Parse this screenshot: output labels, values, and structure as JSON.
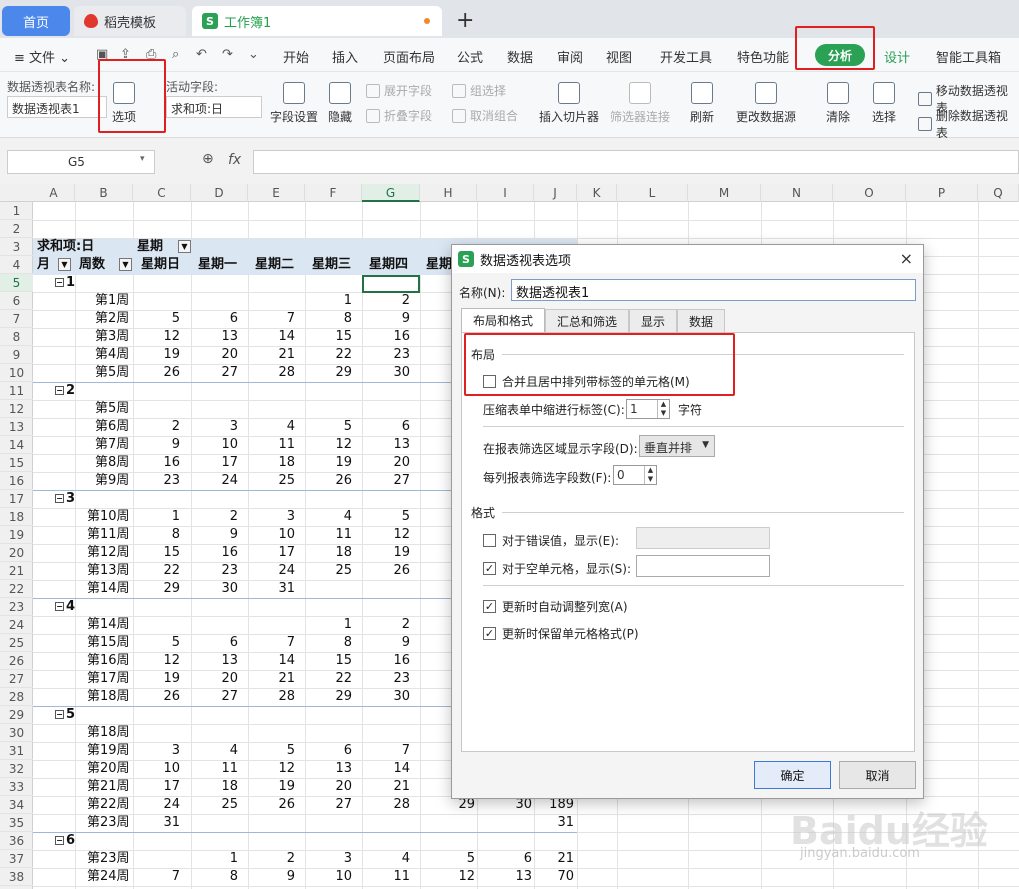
{
  "tabs": {
    "home": "首页",
    "templates": "稻壳模板",
    "workbook": "工作簿1",
    "new_tab": "+"
  },
  "menu": {
    "file": "文件",
    "items": [
      "开始",
      "插入",
      "页面布局",
      "公式",
      "数据",
      "审阅",
      "视图",
      "开发工具",
      "特色功能"
    ],
    "analyze": "分析",
    "design": "设计",
    "smart": "智能工具箱"
  },
  "ribbon": {
    "pivot_name_label": "数据透视表名称:",
    "pivot_name_value": "数据透视表1",
    "options": "选项",
    "active_field_label": "活动字段:",
    "active_field_value": "求和项:日",
    "field_settings": "字段设置",
    "hide": "隐藏",
    "expand_field": "展开字段",
    "collapse_field": "折叠字段",
    "group_selection": "组选择",
    "ungroup": "取消组合",
    "insert_slicer": "插入切片器",
    "filter_connections": "筛选器连接",
    "refresh": "刷新",
    "change_source": "更改数据源",
    "clear": "清除",
    "select": "选择",
    "move_pivot": "移动数据透视表",
    "delete_pivot": "删除数据透视表"
  },
  "formula_bar": {
    "cell_ref": "G5",
    "fx": "fx",
    "formula": ""
  },
  "columns": [
    "A",
    "B",
    "C",
    "D",
    "E",
    "F",
    "G",
    "H",
    "I",
    "J",
    "K",
    "L",
    "M",
    "N",
    "O",
    "P",
    "Q"
  ],
  "rows": [
    "1",
    "2",
    "3",
    "4",
    "5",
    "6",
    "7",
    "8",
    "9",
    "10",
    "11",
    "12",
    "13",
    "14",
    "15",
    "16",
    "17",
    "18",
    "19",
    "20",
    "21",
    "22",
    "23",
    "24",
    "25",
    "26",
    "27",
    "28",
    "29",
    "30",
    "31",
    "32",
    "33",
    "34",
    "35",
    "36",
    "37",
    "38"
  ],
  "pivot": {
    "sum_label": "求和项:日",
    "col_field": "星期",
    "row_field1": "月",
    "row_field2": "周数",
    "day_headers": [
      "星期日",
      "星期一",
      "星期二",
      "星期三",
      "星期四",
      "星期"
    ],
    "rows": [
      {
        "group": "1"
      },
      {
        "week": "第1周",
        "vals": [
          "",
          "",
          "",
          "1",
          "2"
        ]
      },
      {
        "week": "第2周",
        "vals": [
          "5",
          "6",
          "7",
          "8",
          "9"
        ]
      },
      {
        "week": "第3周",
        "vals": [
          "12",
          "13",
          "14",
          "15",
          "16"
        ]
      },
      {
        "week": "第4周",
        "vals": [
          "19",
          "20",
          "21",
          "22",
          "23"
        ]
      },
      {
        "week": "第5周",
        "vals": [
          "26",
          "27",
          "28",
          "29",
          "30"
        ]
      },
      {
        "group": "2"
      },
      {
        "week": "第5周",
        "vals": [
          "",
          "",
          "",
          "",
          ""
        ]
      },
      {
        "week": "第6周",
        "vals": [
          "2",
          "3",
          "4",
          "5",
          "6"
        ]
      },
      {
        "week": "第7周",
        "vals": [
          "9",
          "10",
          "11",
          "12",
          "13"
        ]
      },
      {
        "week": "第8周",
        "vals": [
          "16",
          "17",
          "18",
          "19",
          "20"
        ]
      },
      {
        "week": "第9周",
        "vals": [
          "23",
          "24",
          "25",
          "26",
          "27"
        ]
      },
      {
        "group": "3"
      },
      {
        "week": "第10周",
        "vals": [
          "1",
          "2",
          "3",
          "4",
          "5"
        ]
      },
      {
        "week": "第11周",
        "vals": [
          "8",
          "9",
          "10",
          "11",
          "12"
        ]
      },
      {
        "week": "第12周",
        "vals": [
          "15",
          "16",
          "17",
          "18",
          "19"
        ]
      },
      {
        "week": "第13周",
        "vals": [
          "22",
          "23",
          "24",
          "25",
          "26"
        ]
      },
      {
        "week": "第14周",
        "vals": [
          "29",
          "30",
          "31",
          "",
          ""
        ]
      },
      {
        "group": "4"
      },
      {
        "week": "第14周",
        "vals": [
          "",
          "",
          "",
          "1",
          "2"
        ]
      },
      {
        "week": "第15周",
        "vals": [
          "5",
          "6",
          "7",
          "8",
          "9"
        ]
      },
      {
        "week": "第16周",
        "vals": [
          "12",
          "13",
          "14",
          "15",
          "16"
        ]
      },
      {
        "week": "第17周",
        "vals": [
          "19",
          "20",
          "21",
          "22",
          "23"
        ]
      },
      {
        "week": "第18周",
        "vals": [
          "26",
          "27",
          "28",
          "29",
          "30"
        ]
      },
      {
        "group": "5"
      },
      {
        "week": "第18周",
        "vals": [
          "",
          "",
          "",
          "",
          ""
        ]
      },
      {
        "week": "第19周",
        "vals": [
          "3",
          "4",
          "5",
          "6",
          "7"
        ]
      },
      {
        "week": "第20周",
        "vals": [
          "10",
          "11",
          "12",
          "13",
          "14"
        ]
      },
      {
        "week": "第21周",
        "vals": [
          "17",
          "18",
          "19",
          "20",
          "21"
        ]
      },
      {
        "week": "第22周",
        "vals": [
          "24",
          "25",
          "26",
          "27",
          "28"
        ],
        "extra": [
          "29",
          "30",
          "189"
        ]
      },
      {
        "week": "第23周",
        "vals": [
          "31",
          "",
          "",
          "",
          ""
        ],
        "extra": [
          "",
          "",
          "31"
        ]
      },
      {
        "group": "6"
      },
      {
        "week": "第23周",
        "vals": [
          "",
          "1",
          "2",
          "3",
          "4"
        ],
        "extra": [
          "5",
          "6",
          "21"
        ]
      },
      {
        "week": "第24周",
        "vals": [
          "7",
          "8",
          "9",
          "10",
          "11"
        ],
        "extra": [
          "12",
          "13",
          "70"
        ]
      }
    ]
  },
  "dialog": {
    "title": "数据透视表选项",
    "close": "×",
    "name_label": "名称(N):",
    "name_value": "数据透视表1",
    "tabs": [
      "布局和格式",
      "汇总和筛选",
      "显示",
      "数据"
    ],
    "layout_section": "布局",
    "merge_center": "合并且居中排列带标签的单元格(M)",
    "indent_label": "压缩表单中缩进行标签(C):",
    "indent_value": "1",
    "indent_unit": "字符",
    "filter_area_label": "在报表筛选区域显示字段(D):",
    "filter_area_value": "垂直并排",
    "fields_per_col_label": "每列报表筛选字段数(F):",
    "fields_per_col_value": "0",
    "format_section": "格式",
    "error_label": "对于错误值，显示(E):",
    "empty_label": "对于空单元格，显示(S):",
    "autofit_label": "更新时自动调整列宽(A)",
    "preserve_label": "更新时保留单元格格式(P)",
    "ok": "确定",
    "cancel": "取消"
  },
  "watermark": {
    "brand": "Baidu经验",
    "url": "jingyan.baidu.com"
  },
  "colors": {
    "wps_green": "#2aa154",
    "highlight_red": "#e02020",
    "tab_blue": "#4c87ec"
  }
}
